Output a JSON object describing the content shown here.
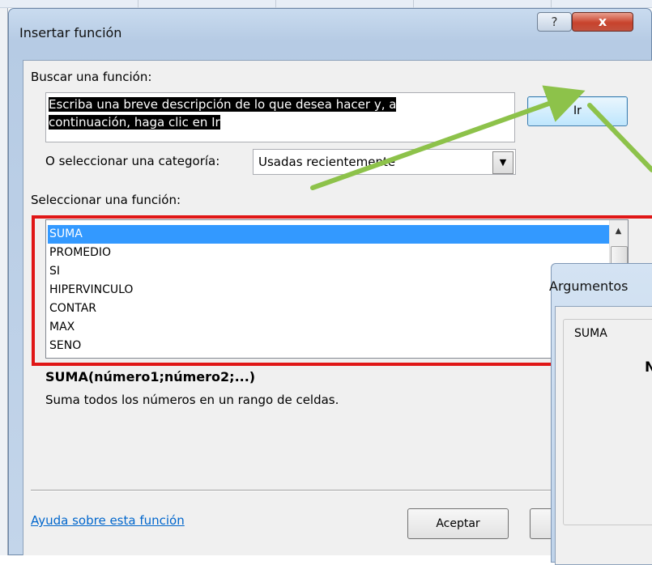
{
  "window": {
    "title": "Insertar función",
    "help_glyph": "?",
    "close_glyph": "x"
  },
  "search": {
    "label": "Buscar una función:",
    "accesskey_label_prefix": "",
    "value_line1": "Escriba una breve descripción de lo que desea hacer y, a",
    "value_line2": "continuación, haga clic en Ir",
    "go_label": "Ir"
  },
  "category": {
    "label": "O seleccionar una categoría:",
    "selected": "Usadas recientemente",
    "arrow_icon": "chevron-down-icon",
    "arrow_glyph": "▼"
  },
  "functions": {
    "label": "Seleccionar una función:",
    "items": [
      "SUMA",
      "PROMEDIO",
      "SI",
      "HIPERVINCULO",
      "CONTAR",
      "MAX",
      "SENO"
    ],
    "selected_index": 0,
    "scroll_up_glyph": "▲"
  },
  "detail": {
    "syntax": "SUMA(número1;número2;...)",
    "description": "Suma todos los números en un rango de celdas."
  },
  "footer": {
    "help_link": "Ayuda sobre esta función",
    "ok_label": "Aceptar"
  },
  "second_dialog": {
    "title": "Argumentos",
    "group_label": "SUMA",
    "partial_glyph": "N"
  },
  "colors": {
    "selection": "#3399ff",
    "highlight_frame": "#e01717",
    "annotation_arrow": "#8dc24a",
    "link": "#0066cc"
  }
}
